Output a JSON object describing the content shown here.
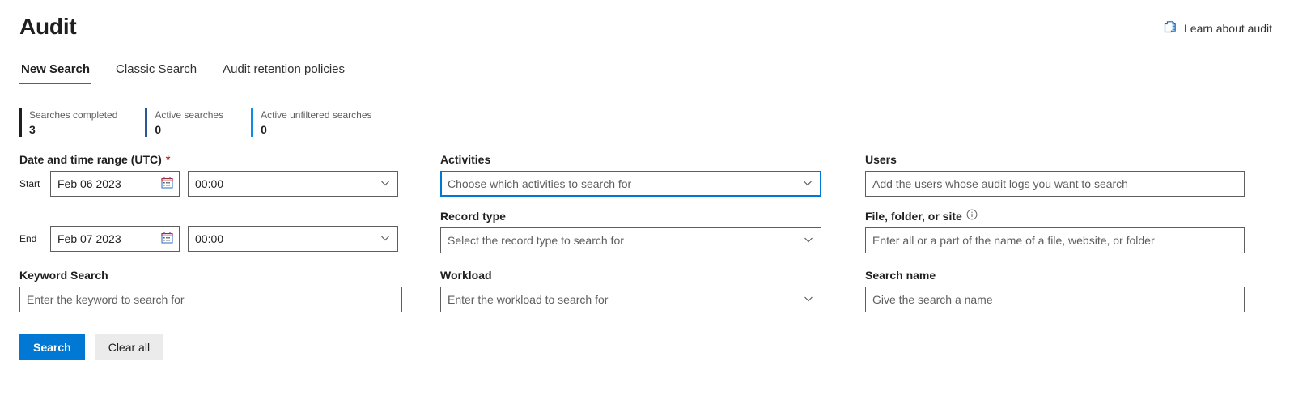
{
  "header": {
    "title": "Audit",
    "learn_link": {
      "label": "Learn about audit",
      "icon": "documentation-icon"
    }
  },
  "tabs": [
    {
      "label": "New Search",
      "active": true
    },
    {
      "label": "Classic Search",
      "active": false
    },
    {
      "label": "Audit retention policies",
      "active": false
    }
  ],
  "stats": [
    {
      "label": "Searches completed",
      "value": "3",
      "color": "#201f1e"
    },
    {
      "label": "Active searches",
      "value": "0",
      "color": "#2b5797"
    },
    {
      "label": "Active unfiltered searches",
      "value": "0",
      "color": "#0d8ce8"
    }
  ],
  "form": {
    "date_range": {
      "label": "Date and time range (UTC)",
      "required_marker": "*",
      "start": {
        "prefix": "Start",
        "date_value": "Feb 06 2023",
        "time_value": "00:00",
        "date_icon": "calendar-icon",
        "time_icon": "chevron-down-icon"
      },
      "end": {
        "prefix": "End",
        "date_value": "Feb 07 2023",
        "time_value": "00:00",
        "date_icon": "calendar-icon",
        "time_icon": "chevron-down-icon"
      }
    },
    "keyword_search": {
      "label": "Keyword Search",
      "placeholder": "Enter the keyword to search for"
    },
    "activities": {
      "label": "Activities",
      "placeholder": "Choose which activities to search for",
      "focused": true,
      "icon": "chevron-down-icon"
    },
    "record_type": {
      "label": "Record type",
      "placeholder": "Select the record type to search for",
      "icon": "chevron-down-icon"
    },
    "workload": {
      "label": "Workload",
      "placeholder": "Enter the workload to search for",
      "icon": "chevron-down-icon"
    },
    "users": {
      "label": "Users",
      "placeholder": "Add the users whose audit logs you want to search"
    },
    "file_folder_site": {
      "label": "File, folder, or site",
      "info_icon": "info-icon",
      "placeholder": "Enter all or a part of the name of a file, website, or folder"
    },
    "search_name": {
      "label": "Search name",
      "placeholder": "Give the search a name"
    }
  },
  "actions": {
    "search_label": "Search",
    "clear_label": "Clear all"
  },
  "colors": {
    "accent": "#0078d4",
    "required": "#a4262c",
    "border": "#605e5c",
    "placeholder": "#605e5c"
  }
}
